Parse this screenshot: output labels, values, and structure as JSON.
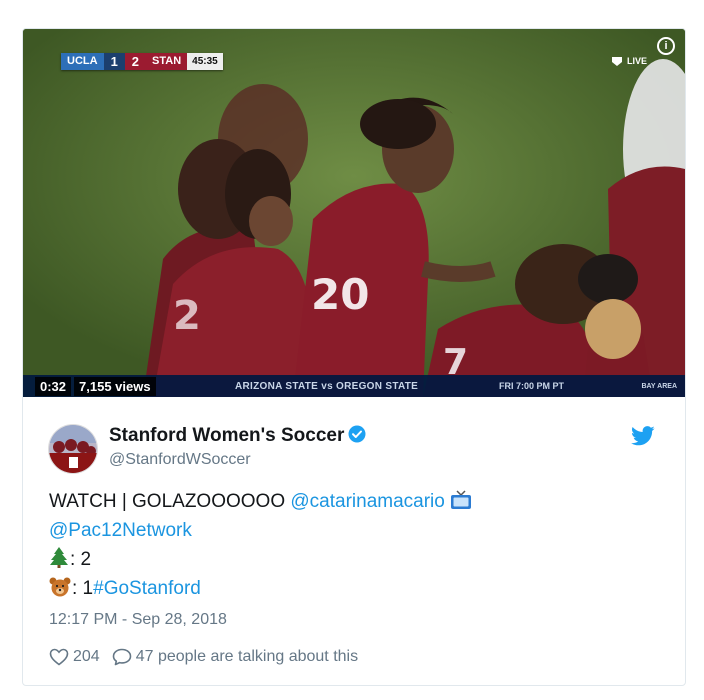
{
  "video": {
    "scorebar": {
      "team1": "UCLA",
      "team1_score": "1",
      "team2_score": "2",
      "team2": "STAN",
      "clock": "45:35"
    },
    "live_label": "LIVE",
    "info_glyph": "i",
    "duration": "0:32",
    "views": "7,155 views",
    "ticker_matchup": "ARIZONA STATE  vs  OREGON STATE",
    "ticker_time": "FRI 7:00 PM PT",
    "ticker_network": "BAY AREA"
  },
  "tweet": {
    "author_name": "Stanford Women's Soccer",
    "author_handle": "@StanfordWSoccer",
    "text": {
      "line1_prefix": "WATCH | GOLAZOOOOOO ",
      "mention1": "@catarinamacario",
      "mention2": "@Pac12Network",
      "line3": ": 2",
      "line4_prefix": ": 1",
      "hashtag": "#GoStanford"
    },
    "timestamp": "12:17 PM - Sep 28, 2018",
    "likes": "204",
    "talking": "47 people are talking about this"
  },
  "colors": {
    "link": "#1b95e0",
    "twitter_blue": "#1da1f2",
    "muted": "#657786",
    "stanford_cardinal": "#8c1515"
  },
  "icons": [
    "info-icon",
    "pac12-logo-icon",
    "verified-badge-icon",
    "twitter-bird-icon",
    "tv-emoji-icon",
    "tree-emoji-icon",
    "bear-emoji-icon",
    "heart-icon",
    "reply-bubble-icon"
  ]
}
